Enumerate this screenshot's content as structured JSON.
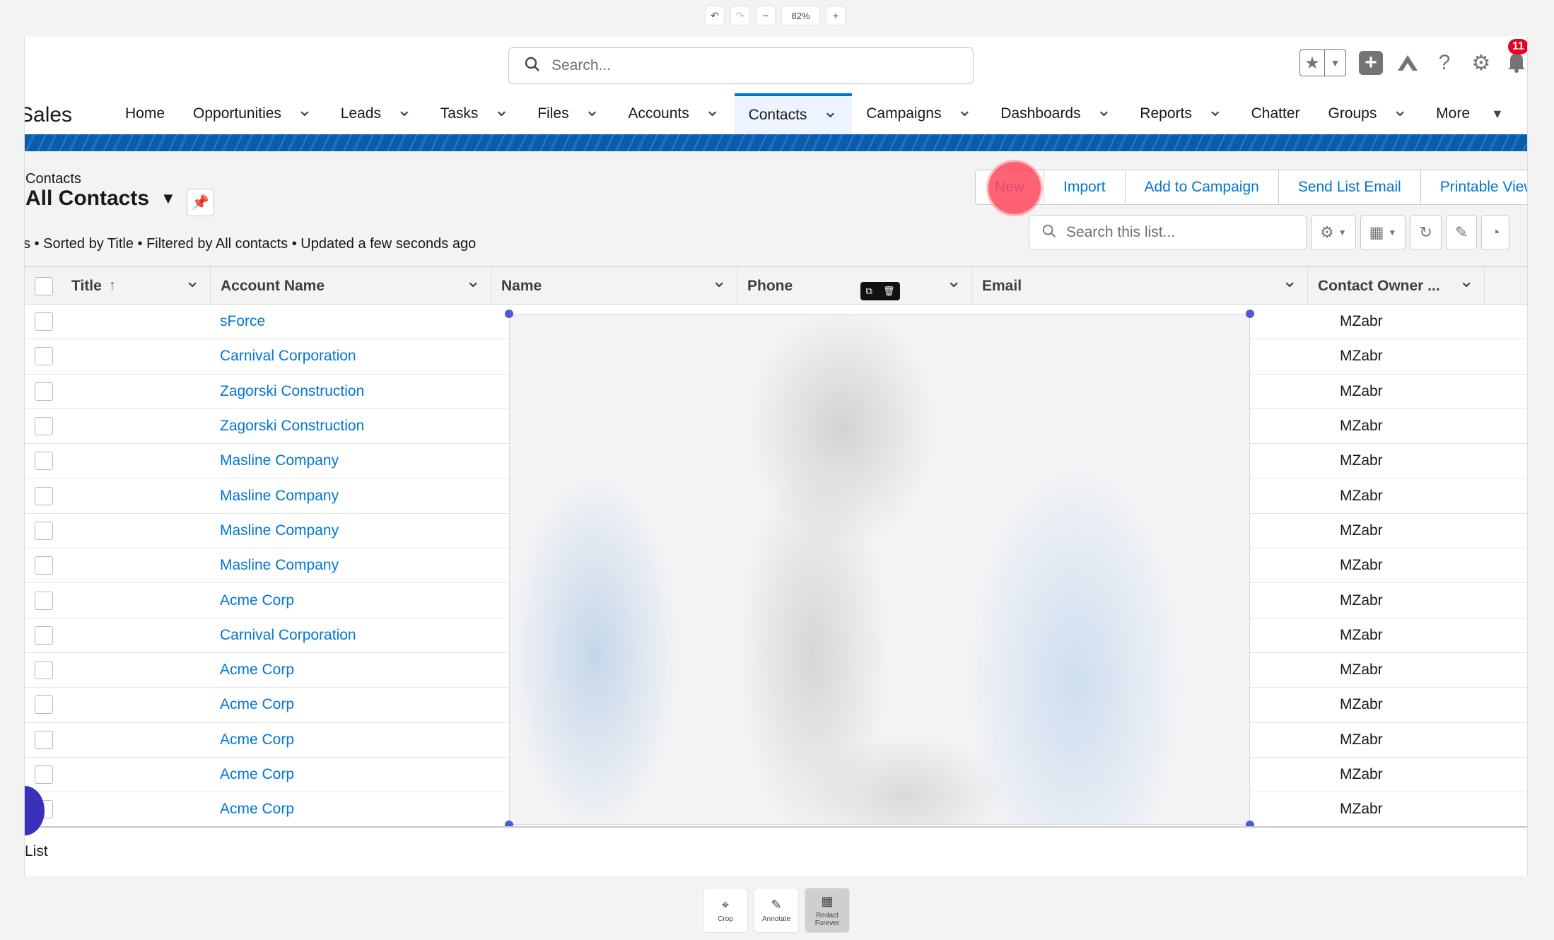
{
  "editor": {
    "undo_icon": "undo-icon",
    "redo_icon": "redo-icon",
    "zoom_out": "−",
    "zoom_level": "82%",
    "zoom_in": "+",
    "bottom_tools": [
      {
        "label": "Crop",
        "icon": "crop-icon"
      },
      {
        "label": "Annotate",
        "icon": "pencil-icon"
      },
      {
        "label": "Redact Forever",
        "icon": "redact-icon"
      }
    ]
  },
  "header": {
    "search_placeholder": "Search...",
    "notification_count": "11"
  },
  "nav": {
    "app_name": "Sales",
    "items": [
      {
        "label": "Home",
        "chevron": false
      },
      {
        "label": "Opportunities",
        "chevron": true
      },
      {
        "label": "Leads",
        "chevron": true
      },
      {
        "label": "Tasks",
        "chevron": true
      },
      {
        "label": "Files",
        "chevron": true
      },
      {
        "label": "Accounts",
        "chevron": true
      },
      {
        "label": "Contacts",
        "chevron": true,
        "active": true
      },
      {
        "label": "Campaigns",
        "chevron": true
      },
      {
        "label": "Dashboards",
        "chevron": true
      },
      {
        "label": "Reports",
        "chevron": true
      },
      {
        "label": "Chatter",
        "chevron": false
      },
      {
        "label": "Groups",
        "chevron": true
      },
      {
        "label": "More",
        "chevron": true
      }
    ]
  },
  "list_view": {
    "object_label": "Contacts",
    "title": "All Contacts",
    "meta": "s • Sorted by Title • Filtered by All contacts • Updated a few seconds ago",
    "actions": [
      "New",
      "Import",
      "Add to Campaign",
      "Send List Email",
      "Printable View"
    ],
    "search_placeholder": "Search this list...",
    "footer": "List"
  },
  "table": {
    "columns": [
      "Title",
      "Account Name",
      "Name",
      "Phone",
      "Email",
      "Contact Owner ..."
    ],
    "rows": [
      {
        "account": "sForce",
        "owner": "MZabr"
      },
      {
        "account": "Carnival Corporation",
        "owner": "MZabr"
      },
      {
        "account": "Zagorski Construction",
        "owner": "MZabr"
      },
      {
        "account": "Zagorski Construction",
        "owner": "MZabr"
      },
      {
        "account": "Masline Company",
        "owner": "MZabr"
      },
      {
        "account": "Masline Company",
        "owner": "MZabr"
      },
      {
        "account": "Masline Company",
        "owner": "MZabr"
      },
      {
        "account": "Masline Company",
        "owner": "MZabr"
      },
      {
        "account": "Acme Corp",
        "owner": "MZabr"
      },
      {
        "account": "Carnival Corporation",
        "owner": "MZabr"
      },
      {
        "account": "Acme Corp",
        "owner": "MZabr"
      },
      {
        "account": "Acme Corp",
        "owner": "MZabr"
      },
      {
        "account": "Acme Corp",
        "owner": "MZabr"
      },
      {
        "account": "Acme Corp",
        "owner": "MZabr"
      },
      {
        "account": "Acme Corp",
        "owner": "MZabr"
      }
    ]
  },
  "colors": {
    "brand_blue": "#0176d3",
    "click_highlight": "#ff465a",
    "redact_handle": "#4f5bd5"
  }
}
